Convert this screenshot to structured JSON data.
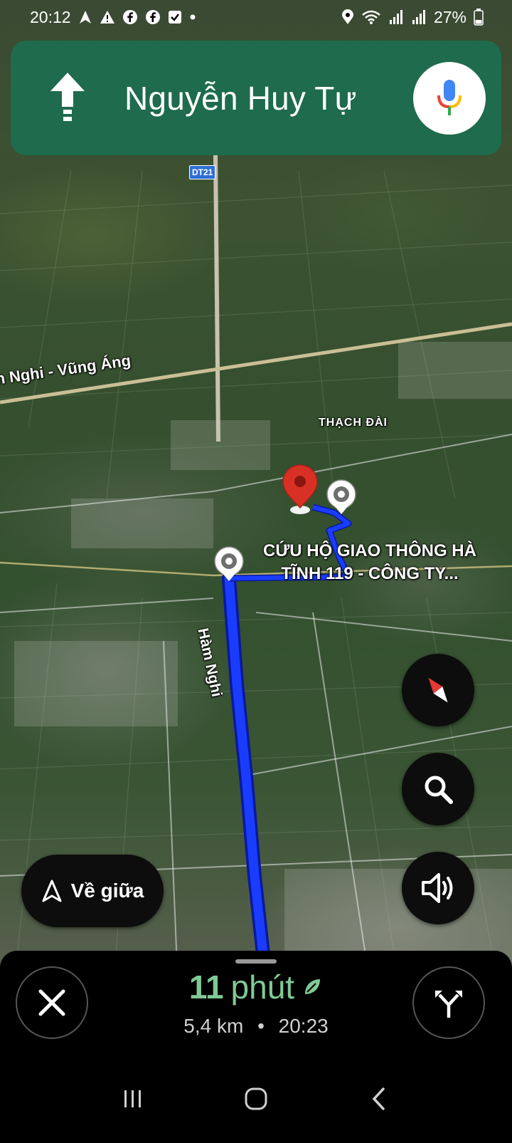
{
  "status_bar": {
    "time": "20:12",
    "battery": "27%"
  },
  "nav_banner": {
    "maneuver": "straight-arrow-icon",
    "street": "Nguyễn Huy Tự",
    "background_color": "#1e6b4d"
  },
  "map": {
    "road_shield": "DT21",
    "highway_label": "n Nghi - Vũng Áng",
    "area_label": "THẠCH ĐÀI",
    "street_label": "Hàm Nghi",
    "destination_name": "CỨU HỘ GIAO THÔNG HÀ TĨNH 119 - CÔNG TY...",
    "route_color": "#1a3cff"
  },
  "controls": {
    "recenter_label": "Về giữa"
  },
  "trip": {
    "duration_value": "11",
    "duration_unit": "phút",
    "distance": "5,4 km",
    "separator": "•",
    "arrival_time": "20:23",
    "eta_color": "#81c995"
  }
}
